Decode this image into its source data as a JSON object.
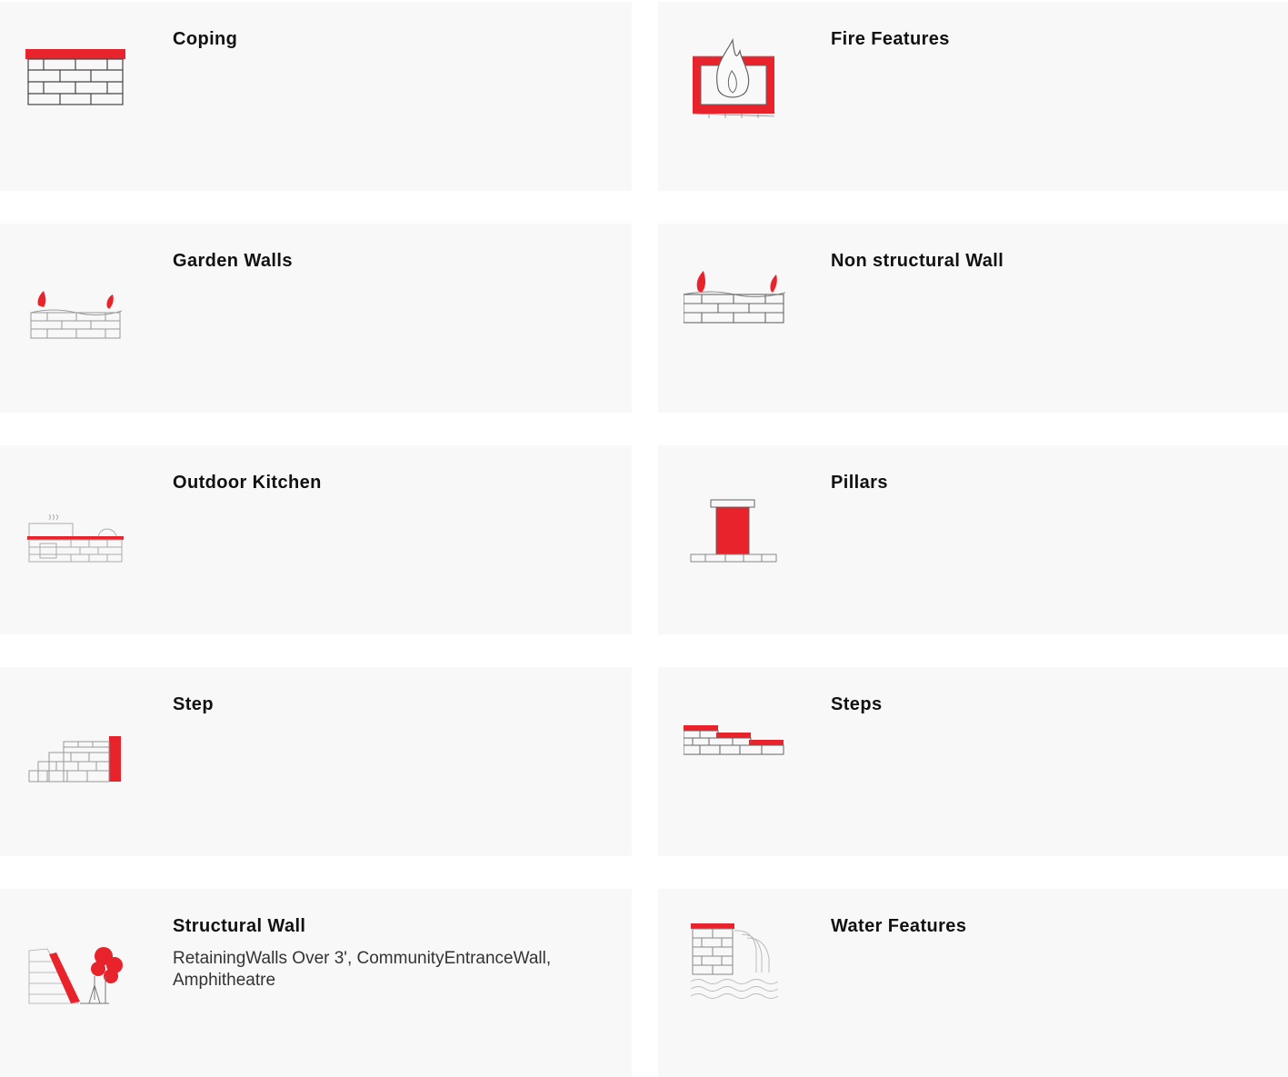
{
  "accent_color": "#e8232b",
  "cards": [
    {
      "title": "Coping",
      "desc": "",
      "icon": "coping-wall-icon"
    },
    {
      "title": "Fire Features",
      "desc": "",
      "icon": "fire-feature-icon"
    },
    {
      "title": "Garden Walls",
      "desc": "",
      "icon": "garden-wall-icon"
    },
    {
      "title": "Non structural Wall",
      "desc": "",
      "icon": "non-structural-wall-icon"
    },
    {
      "title": "Outdoor Kitchen",
      "desc": "",
      "icon": "outdoor-kitchen-icon"
    },
    {
      "title": "Pillars",
      "desc": "",
      "icon": "pillar-icon"
    },
    {
      "title": "Step",
      "desc": "",
      "icon": "step-icon"
    },
    {
      "title": "Steps",
      "desc": "",
      "icon": "steps-icon"
    },
    {
      "title": "Structural Wall",
      "desc": "RetainingWalls Over 3', CommunityEntranceWall, Amphitheatre",
      "icon": "structural-wall-icon"
    },
    {
      "title": "Water Features",
      "desc": "",
      "icon": "water-feature-icon"
    }
  ]
}
